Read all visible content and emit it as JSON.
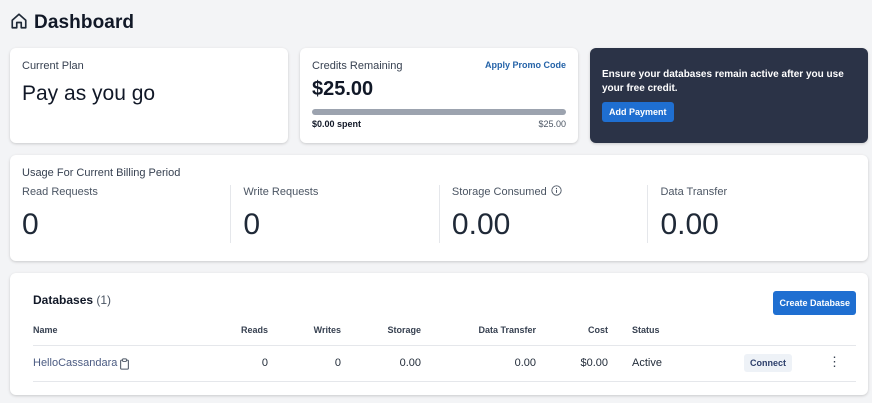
{
  "header": {
    "title": "Dashboard",
    "icon": "home-icon"
  },
  "plan": {
    "label": "Current Plan",
    "value": "Pay as you go"
  },
  "credits": {
    "label": "Credits Remaining",
    "promo_link": "Apply Promo Code",
    "amount": "$25.00",
    "spent_label": "$0.00 spent",
    "total_label": "$25.00",
    "progress_fraction": 1.0
  },
  "cta": {
    "message": "Ensure your databases remain active after you use your free credit.",
    "button": "Add Payment"
  },
  "usage": {
    "title": "Usage For Current Billing Period",
    "metrics": [
      {
        "name": "Read Requests",
        "value": "0"
      },
      {
        "name": "Write Requests",
        "value": "0"
      },
      {
        "name": "Storage Consumed",
        "value": "0.00"
      },
      {
        "name": "Data Transfer",
        "value": "0.00"
      }
    ]
  },
  "databases": {
    "title": "Databases",
    "count": "(1)",
    "create_button": "Create Database",
    "columns": [
      "Name",
      "Reads",
      "Writes",
      "Storage",
      "Data Transfer",
      "Cost",
      "Status"
    ],
    "rows": [
      {
        "name": "HelloCassandara",
        "reads": "0",
        "writes": "0",
        "storage": "0.00",
        "data_transfer": "0.00",
        "cost": "$0.00",
        "status": "Active",
        "action": "Connect"
      }
    ]
  },
  "colors": {
    "accent": "#1f6fd1",
    "dark_card": "#2b3347",
    "link": "#2563a8"
  }
}
